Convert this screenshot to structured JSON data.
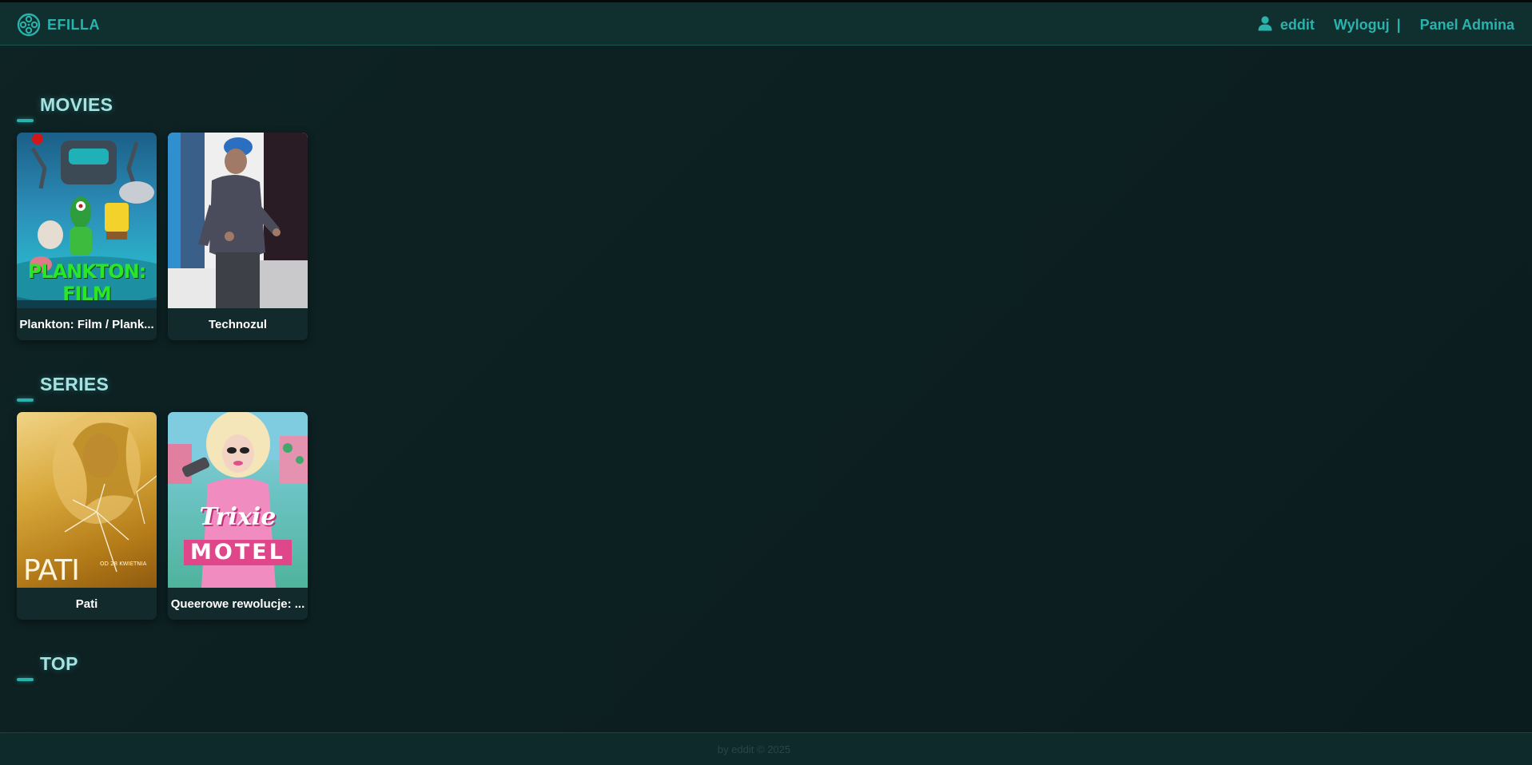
{
  "brand": {
    "name": "EFILLA",
    "icon": "film-reel-icon"
  },
  "nav": {
    "user_icon": "user-icon",
    "username": "eddit",
    "logout": "Wyloguj",
    "separator": "|",
    "admin": "Panel Admina"
  },
  "sections": {
    "movies": {
      "title": "MOVIES",
      "items": [
        {
          "title": "Plankton: Film / Plank...",
          "poster_text": "PLANKTON: FILM"
        },
        {
          "title": "Technozul"
        }
      ]
    },
    "series": {
      "title": "SERIES",
      "items": [
        {
          "title": "Pati",
          "poster_text": "PATI",
          "poster_subtext": "OD 28 KWIETNIA"
        },
        {
          "title": "Queerowe rewolucje: ...",
          "poster_text_1": "Trixie",
          "poster_text_2": "MOTEL"
        }
      ]
    },
    "top": {
      "title": "TOP"
    }
  },
  "footer": {
    "text": "by eddit © 2025"
  },
  "colors": {
    "accent": "#2ab3ad",
    "section_title": "#a5e3e3",
    "background": "#0c1f21",
    "navbar": "#10302f"
  }
}
